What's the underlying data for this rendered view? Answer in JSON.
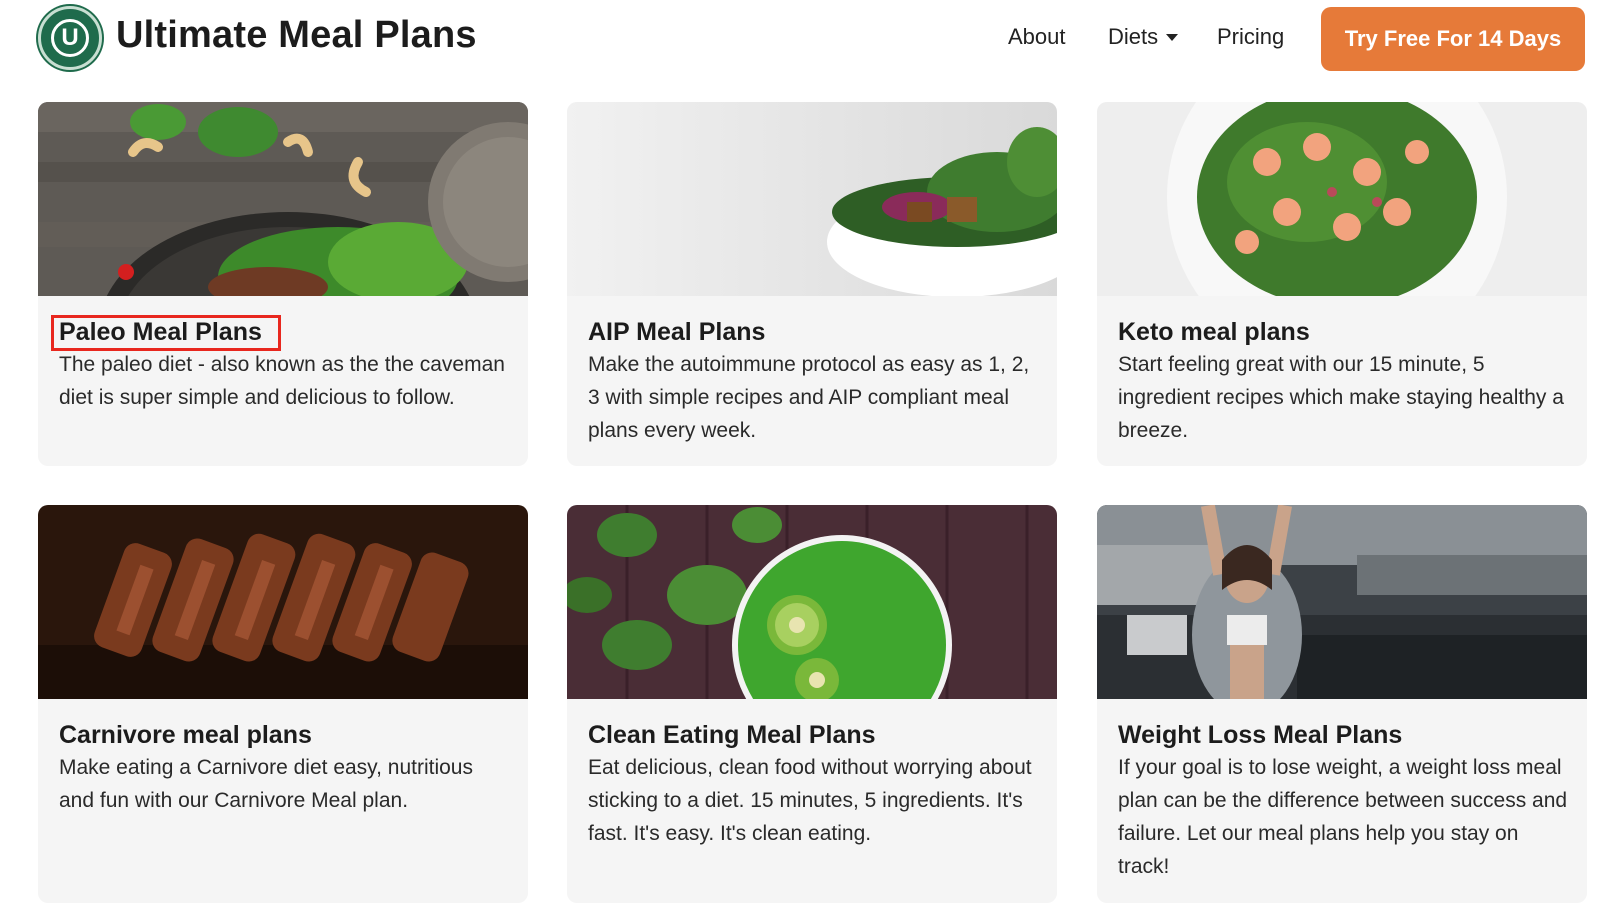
{
  "header": {
    "brand": "Ultimate Meal Plans",
    "logo_letter": "U",
    "nav": {
      "about": "About",
      "diets": "Diets",
      "pricing": "Pricing"
    },
    "cta": "Try Free For 14 Days"
  },
  "colors": {
    "accent": "#e67a39",
    "brand_green": "#1f6b4c",
    "highlight": "#e8271e",
    "card_bg": "#f5f5f5"
  },
  "cards": [
    {
      "title": "Paleo Meal Plans",
      "desc": "The paleo diet - also known as the the caveman diet is super simple and delicious to follow.",
      "image": "paleo-food-photo"
    },
    {
      "title": "AIP Meal Plans",
      "desc": "Make the autoimmune protocol as easy as 1, 2, 3 with simple recipes and AIP compliant meal plans every week.",
      "image": "salad-bowl-photo"
    },
    {
      "title": "Keto meal plans",
      "desc": "Start feeling great with our 15 minute, 5 ingredient recipes which make staying healthy a breeze.",
      "image": "shrimp-salad-photo"
    },
    {
      "title": "Carnivore meal plans",
      "desc": "Make eating a Carnivore diet easy, nutritious and fun with our Carnivore Meal plan.",
      "image": "steak-photo"
    },
    {
      "title": "Clean Eating Meal Plans",
      "desc": "Eat delicious, clean food without worrying about sticking to a diet. 15 minutes, 5 ingredients. It's fast. It's easy. It's clean eating.",
      "image": "green-smoothie-photo"
    },
    {
      "title": "Weight Loss Meal Plans",
      "desc": "If your goal is to lose weight, a weight loss meal plan can be the difference between success and failure. Let our meal plans help you stay on track!",
      "image": "woman-stretching-photo"
    }
  ]
}
